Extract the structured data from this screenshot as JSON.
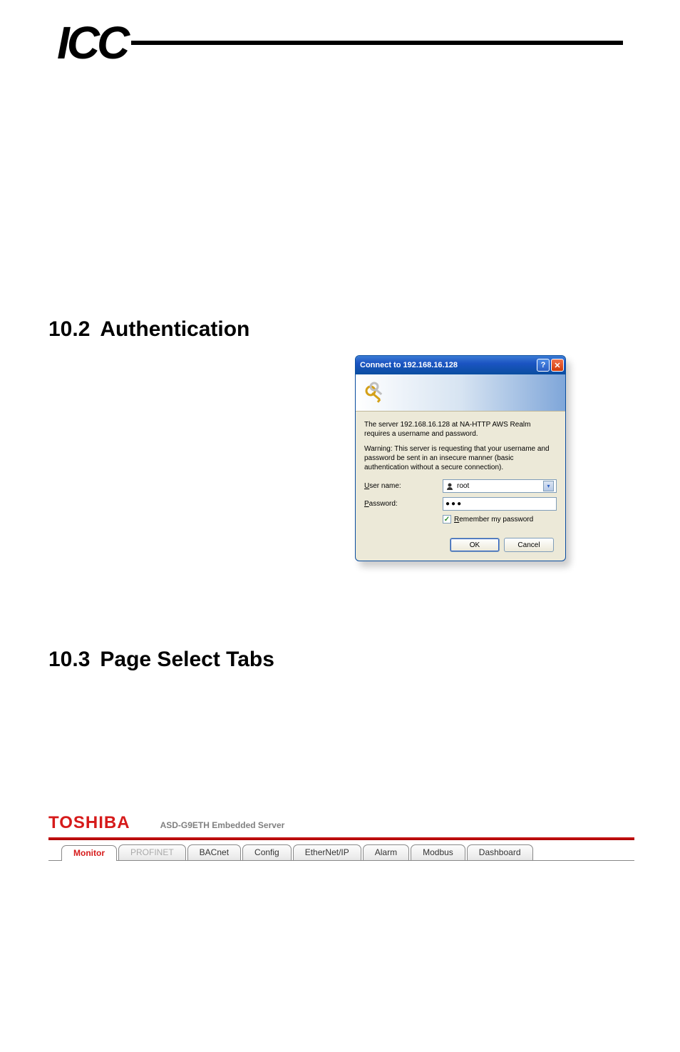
{
  "header": {
    "logo_text": "ICC"
  },
  "sections": {
    "auth_number": "10.2",
    "auth_title": "Authentication",
    "tabs_number": "10.3",
    "tabs_title": "Page Select Tabs"
  },
  "dialog": {
    "title": "Connect to 192.168.16.128",
    "message1": "The server 192.168.16.128 at NA-HTTP AWS Realm requires a username and password.",
    "message2": "Warning: This server is requesting that your username and password be sent in an insecure manner (basic authentication without a secure connection).",
    "username_label_pre": "U",
    "username_label_rest": "ser name:",
    "password_label_pre": "P",
    "password_label_rest": "assword:",
    "username_value": "root",
    "password_value": "●●●",
    "remember_pre": "R",
    "remember_rest": "emember my password",
    "remember_checked": true,
    "ok_label": "OK",
    "cancel_label": "Cancel",
    "help_glyph": "?",
    "close_glyph": "✕",
    "dropdown_glyph": "▾",
    "check_glyph": "✓"
  },
  "tabs_figure": {
    "brand": "TOSHIBA",
    "server_title": "ASD-G9ETH Embedded Server",
    "tabs": [
      {
        "label": "Monitor",
        "state": "active"
      },
      {
        "label": "PROFINET",
        "state": "disabled"
      },
      {
        "label": "BACnet",
        "state": "normal"
      },
      {
        "label": "Config",
        "state": "normal"
      },
      {
        "label": "EtherNet/IP",
        "state": "normal"
      },
      {
        "label": "Alarm",
        "state": "normal"
      },
      {
        "label": "Modbus",
        "state": "normal"
      },
      {
        "label": "Dashboard",
        "state": "normal"
      }
    ]
  }
}
